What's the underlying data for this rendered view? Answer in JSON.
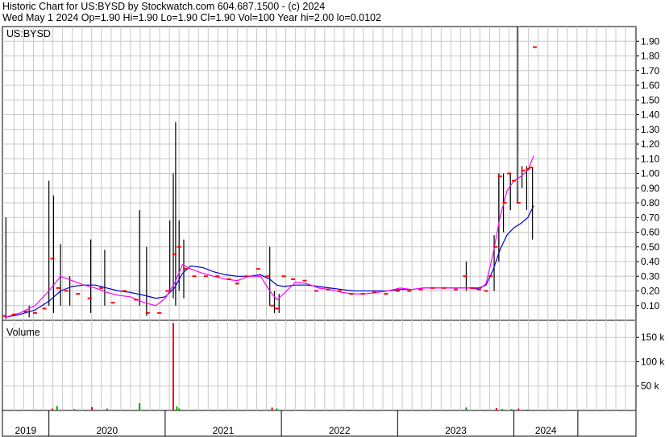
{
  "header": {
    "line1": "Historic Chart for US:BYSD by Stockwatch.com 604.687.1500 - (c) 2024",
    "line2": "Wed May  1 2024   Op=1.90  Hi=1.90  Lo=1.90  Cl=1.90  Vol=100   Year hi=2.00  lo=0.0102"
  },
  "chart_data": {
    "type": "line",
    "symbol_label": "US:BYSD",
    "volume_label": "Volume",
    "price_ticks": [
      "0.10",
      "0.20",
      "0.30",
      "0.40",
      "0.50",
      "0.60",
      "0.70",
      "0.80",
      "0.90",
      "1.00",
      "1.10",
      "1.20",
      "1.30",
      "1.40",
      "1.50",
      "1.60",
      "1.70",
      "1.80",
      "1.90"
    ],
    "price_range": [
      0,
      2.0
    ],
    "volume_ticks": [
      "50 k",
      "100 k",
      "150 k"
    ],
    "volume_range": [
      0,
      185000
    ],
    "years": [
      "2019",
      "2020",
      "2021",
      "2022",
      "2023",
      "2024"
    ],
    "year_start": [
      2018.9,
      2019.3,
      2020.3,
      2021.3,
      2022.3,
      2023.3,
      2023.85
    ],
    "x_range": [
      2018.9,
      2024.35
    ],
    "colors": {
      "price": "#ff0000",
      "range": "#000000",
      "ma_short": "#ff00ff",
      "ma_long": "#0000cc",
      "vol_up": "#00aa00",
      "vol_down": "#ff0000",
      "grid": "#c8c8c8"
    },
    "close_points": [
      [
        2018.92,
        0.03
      ],
      [
        2019.0,
        0.04
      ],
      [
        2019.1,
        0.06
      ],
      [
        2019.18,
        0.05
      ],
      [
        2019.26,
        0.08
      ],
      [
        2019.33,
        0.42
      ],
      [
        2019.38,
        0.22
      ],
      [
        2019.45,
        0.2
      ],
      [
        2019.55,
        0.18
      ],
      [
        2019.65,
        0.15
      ],
      [
        2019.75,
        0.22
      ],
      [
        2019.85,
        0.12
      ],
      [
        2019.95,
        0.2
      ],
      [
        2020.05,
        0.14
      ],
      [
        2020.15,
        0.05
      ],
      [
        2020.25,
        0.05
      ],
      [
        2020.32,
        0.2
      ],
      [
        2020.38,
        0.45
      ],
      [
        2020.42,
        0.5
      ],
      [
        2020.48,
        0.35
      ],
      [
        2020.55,
        0.3
      ],
      [
        2020.65,
        0.3
      ],
      [
        2020.75,
        0.3
      ],
      [
        2020.85,
        0.28
      ],
      [
        2020.92,
        0.25
      ],
      [
        2021.0,
        0.3
      ],
      [
        2021.1,
        0.35
      ],
      [
        2021.18,
        0.3
      ],
      [
        2021.22,
        0.1
      ],
      [
        2021.26,
        0.08
      ],
      [
        2021.32,
        0.3
      ],
      [
        2021.4,
        0.28
      ],
      [
        2021.5,
        0.27
      ],
      [
        2021.6,
        0.2
      ],
      [
        2021.7,
        0.21
      ],
      [
        2021.8,
        0.2
      ],
      [
        2021.9,
        0.18
      ],
      [
        2022.0,
        0.18
      ],
      [
        2022.1,
        0.19
      ],
      [
        2022.2,
        0.18
      ],
      [
        2022.3,
        0.2
      ],
      [
        2022.4,
        0.2
      ],
      [
        2022.5,
        0.21
      ],
      [
        2022.6,
        0.22
      ],
      [
        2022.7,
        0.22
      ],
      [
        2022.8,
        0.21
      ],
      [
        2022.88,
        0.3
      ],
      [
        2022.94,
        0.22
      ],
      [
        2023.0,
        0.21
      ],
      [
        2023.06,
        0.2
      ],
      [
        2023.1,
        0.3
      ],
      [
        2023.14,
        0.5
      ],
      [
        2023.18,
        0.98
      ],
      [
        2023.22,
        0.8
      ],
      [
        2023.26,
        1.0
      ],
      [
        2023.3,
        0.95
      ],
      [
        2023.34,
        0.8
      ],
      [
        2023.38,
        1.02
      ],
      [
        2023.42,
        1.03
      ],
      [
        2023.45,
        1.04
      ],
      [
        2023.48,
        1.86
      ]
    ],
    "ma_short": [
      [
        2018.92,
        0.02
      ],
      [
        2019.05,
        0.05
      ],
      [
        2019.18,
        0.1
      ],
      [
        2019.3,
        0.2
      ],
      [
        2019.4,
        0.3
      ],
      [
        2019.5,
        0.27
      ],
      [
        2019.6,
        0.24
      ],
      [
        2019.7,
        0.22
      ],
      [
        2019.8,
        0.19
      ],
      [
        2019.9,
        0.17
      ],
      [
        2020.0,
        0.16
      ],
      [
        2020.12,
        0.12
      ],
      [
        2020.22,
        0.1
      ],
      [
        2020.3,
        0.15
      ],
      [
        2020.38,
        0.25
      ],
      [
        2020.45,
        0.38
      ],
      [
        2020.52,
        0.35
      ],
      [
        2020.62,
        0.32
      ],
      [
        2020.72,
        0.3
      ],
      [
        2020.82,
        0.28
      ],
      [
        2020.92,
        0.27
      ],
      [
        2021.02,
        0.3
      ],
      [
        2021.12,
        0.3
      ],
      [
        2021.2,
        0.2
      ],
      [
        2021.26,
        0.14
      ],
      [
        2021.32,
        0.18
      ],
      [
        2021.42,
        0.26
      ],
      [
        2021.52,
        0.25
      ],
      [
        2021.62,
        0.22
      ],
      [
        2021.72,
        0.21
      ],
      [
        2021.82,
        0.19
      ],
      [
        2021.92,
        0.18
      ],
      [
        2022.02,
        0.18
      ],
      [
        2022.12,
        0.19
      ],
      [
        2022.22,
        0.2
      ],
      [
        2022.32,
        0.22
      ],
      [
        2022.42,
        0.21
      ],
      [
        2022.52,
        0.22
      ],
      [
        2022.62,
        0.22
      ],
      [
        2022.72,
        0.22
      ],
      [
        2022.82,
        0.22
      ],
      [
        2022.92,
        0.22
      ],
      [
        2023.0,
        0.21
      ],
      [
        2023.06,
        0.25
      ],
      [
        2023.12,
        0.45
      ],
      [
        2023.18,
        0.7
      ],
      [
        2023.24,
        0.88
      ],
      [
        2023.3,
        0.95
      ],
      [
        2023.36,
        0.98
      ],
      [
        2023.42,
        1.02
      ],
      [
        2023.47,
        1.12
      ]
    ],
    "ma_long": [
      [
        2018.92,
        0.02
      ],
      [
        2019.05,
        0.04
      ],
      [
        2019.18,
        0.07
      ],
      [
        2019.3,
        0.13
      ],
      [
        2019.4,
        0.2
      ],
      [
        2019.5,
        0.23
      ],
      [
        2019.6,
        0.24
      ],
      [
        2019.7,
        0.24
      ],
      [
        2019.8,
        0.22
      ],
      [
        2019.9,
        0.2
      ],
      [
        2020.0,
        0.19
      ],
      [
        2020.12,
        0.17
      ],
      [
        2020.22,
        0.15
      ],
      [
        2020.3,
        0.16
      ],
      [
        2020.38,
        0.22
      ],
      [
        2020.45,
        0.32
      ],
      [
        2020.52,
        0.37
      ],
      [
        2020.62,
        0.36
      ],
      [
        2020.72,
        0.33
      ],
      [
        2020.82,
        0.31
      ],
      [
        2020.92,
        0.3
      ],
      [
        2021.02,
        0.3
      ],
      [
        2021.12,
        0.31
      ],
      [
        2021.2,
        0.28
      ],
      [
        2021.26,
        0.24
      ],
      [
        2021.32,
        0.23
      ],
      [
        2021.42,
        0.24
      ],
      [
        2021.52,
        0.24
      ],
      [
        2021.62,
        0.23
      ],
      [
        2021.72,
        0.22
      ],
      [
        2021.82,
        0.21
      ],
      [
        2021.92,
        0.2
      ],
      [
        2022.02,
        0.2
      ],
      [
        2022.12,
        0.2
      ],
      [
        2022.22,
        0.2
      ],
      [
        2022.32,
        0.21
      ],
      [
        2022.42,
        0.21
      ],
      [
        2022.52,
        0.22
      ],
      [
        2022.62,
        0.22
      ],
      [
        2022.72,
        0.22
      ],
      [
        2022.82,
        0.22
      ],
      [
        2022.92,
        0.22
      ],
      [
        2023.0,
        0.22
      ],
      [
        2023.06,
        0.24
      ],
      [
        2023.12,
        0.34
      ],
      [
        2023.18,
        0.48
      ],
      [
        2023.24,
        0.58
      ],
      [
        2023.3,
        0.63
      ],
      [
        2023.36,
        0.66
      ],
      [
        2023.42,
        0.7
      ],
      [
        2023.47,
        0.78
      ]
    ],
    "range_bars": [
      [
        2018.93,
        0.01,
        0.7
      ],
      [
        2019.13,
        0.02,
        0.1
      ],
      [
        2019.3,
        0.1,
        0.95
      ],
      [
        2019.34,
        0.05,
        0.85
      ],
      [
        2019.4,
        0.1,
        0.52
      ],
      [
        2019.48,
        0.1,
        0.3
      ],
      [
        2019.66,
        0.05,
        0.55
      ],
      [
        2019.78,
        0.1,
        0.48
      ],
      [
        2020.08,
        0.1,
        0.75
      ],
      [
        2020.14,
        0.03,
        0.5
      ],
      [
        2020.34,
        0.2,
        0.68
      ],
      [
        2020.37,
        0.15,
        1.0
      ],
      [
        2020.39,
        0.1,
        1.35
      ],
      [
        2020.42,
        0.2,
        0.68
      ],
      [
        2020.46,
        0.15,
        0.55
      ],
      [
        2021.2,
        0.1,
        0.5
      ],
      [
        2021.24,
        0.05,
        0.2
      ],
      [
        2021.28,
        0.05,
        0.18
      ],
      [
        2022.89,
        0.2,
        0.4
      ],
      [
        2023.13,
        0.2,
        0.58
      ],
      [
        2023.17,
        0.4,
        1.0
      ],
      [
        2023.21,
        0.6,
        1.0
      ],
      [
        2023.27,
        0.75,
        1.0
      ],
      [
        2023.33,
        0.8,
        2.0
      ],
      [
        2023.37,
        0.9,
        1.05
      ],
      [
        2023.41,
        0.75,
        1.05
      ],
      [
        2023.46,
        0.55,
        1.04
      ]
    ],
    "volume_bars": [
      [
        2019.33,
        4000
      ],
      [
        2019.37,
        9000
      ],
      [
        2019.52,
        3000
      ],
      [
        2019.67,
        7000
      ],
      [
        2019.8,
        4000
      ],
      [
        2020.08,
        15000
      ],
      [
        2020.37,
        180000
      ],
      [
        2020.4,
        8000
      ],
      [
        2020.42,
        4000
      ],
      [
        2021.22,
        6000
      ],
      [
        2021.26,
        4000
      ],
      [
        2022.89,
        6000
      ],
      [
        2023.15,
        5000
      ],
      [
        2023.2,
        3000
      ],
      [
        2023.28,
        3000
      ],
      [
        2023.34,
        4000
      ],
      [
        2023.42,
        2000
      ]
    ]
  }
}
